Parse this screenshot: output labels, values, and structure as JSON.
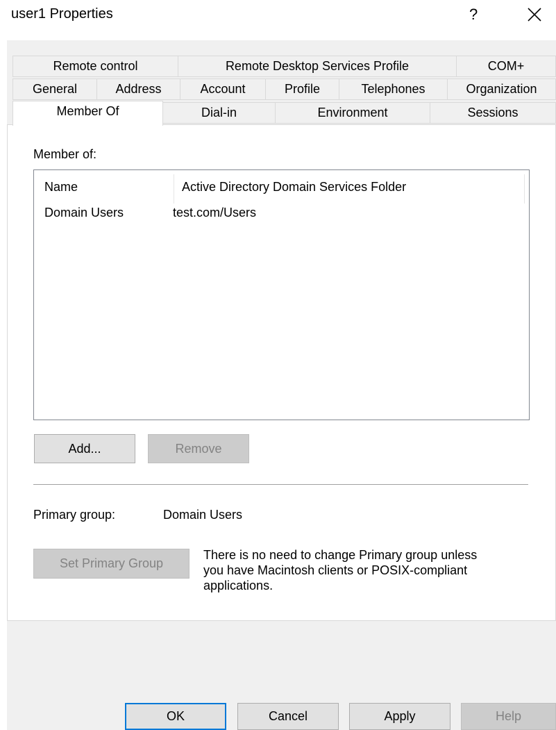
{
  "window": {
    "title": "user1 Properties",
    "help_glyph": "?"
  },
  "tabs": {
    "row1": [
      "Remote control",
      "Remote Desktop Services Profile",
      "COM+"
    ],
    "row2": [
      "General",
      "Address",
      "Account",
      "Profile",
      "Telephones",
      "Organization"
    ],
    "row3": [
      "Member Of",
      "Dial-in",
      "Environment",
      "Sessions"
    ],
    "selected": "Member Of"
  },
  "member_of": {
    "label": "Member of:",
    "columns": [
      "Name",
      "Active Directory Domain Services Folder"
    ],
    "rows": [
      {
        "name": "Domain Users",
        "folder": "test.com/Users"
      }
    ],
    "add_label": "Add...",
    "remove_label": "Remove"
  },
  "primary_group": {
    "label": "Primary group:",
    "value": "Domain Users",
    "set_button_label": "Set Primary Group",
    "note_lines": [
      "There is no need to change Primary group unless",
      "you have Macintosh clients or POSIX-compliant",
      "applications."
    ]
  },
  "footer": {
    "ok_label": "OK",
    "cancel_label": "Cancel",
    "apply_label": "Apply",
    "help_label": "Help"
  },
  "colors": {
    "accent": "#0078d7",
    "dialog_background": "#f0f0f0",
    "panel_background": "#ffffff",
    "disabled_text": "#838383"
  },
  "icons": {
    "close": "close-icon"
  }
}
